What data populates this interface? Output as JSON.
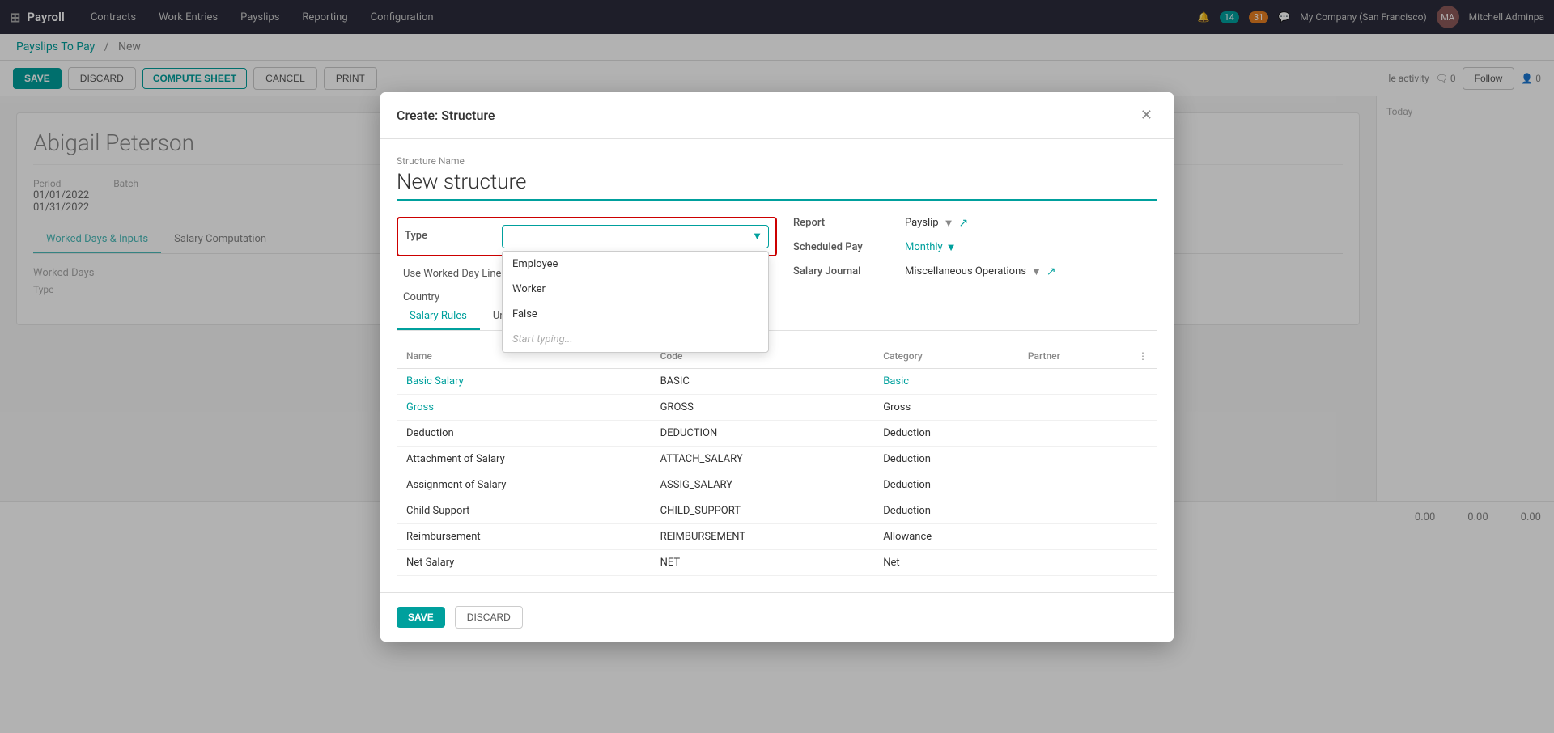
{
  "app": {
    "name": "Payroll",
    "grid_icon": "⊞"
  },
  "nav": {
    "items": [
      {
        "label": "Contracts"
      },
      {
        "label": "Work Entries"
      },
      {
        "label": "Payslips"
      },
      {
        "label": "Reporting"
      },
      {
        "label": "Configuration"
      }
    ]
  },
  "nav_right": {
    "badge1": "14",
    "badge2": "31",
    "company": "My Company (San Francisco)",
    "user": "Mitchell Adminpa"
  },
  "breadcrumb": {
    "parent": "Payslips To Pay",
    "current": "New"
  },
  "toolbar": {
    "save_label": "SAVE",
    "discard_label": "DISCARD",
    "compute_sheet_label": "COMPUTE SHEET",
    "cancel_label": "CANCEL",
    "print_label": "PRINT"
  },
  "employee": {
    "name": "Abigail Peterson",
    "period_label": "Period",
    "period_start": "01/01/2022",
    "period_end": "01/31/2022",
    "batch_label": "Batch"
  },
  "tabs": [
    {
      "label": "Worked Days & Inputs",
      "active": true
    },
    {
      "label": "Salary Computation"
    }
  ],
  "worked_days": {
    "title": "Worked Days",
    "type_label": "Type"
  },
  "sidebar": {
    "today_label": "Today",
    "follow_label": "Follow",
    "msg_count": "0",
    "follower_count": "0"
  },
  "modal": {
    "title": "Create: Structure",
    "structure_name_label": "Structure Name",
    "structure_name": "New structure",
    "type_label": "Type",
    "use_worked_day_label": "Use Worked Day Lines",
    "country_label": "Country",
    "report_label": "Report",
    "report_value": "Payslip",
    "scheduled_pay_label": "Scheduled Pay",
    "scheduled_pay_value": "Monthly",
    "salary_journal_label": "Salary Journal",
    "salary_journal_value": "Miscellaneous Operations",
    "type_options": [
      {
        "label": "Employee",
        "selected": false
      },
      {
        "label": "Worker",
        "selected": false
      },
      {
        "label": "False",
        "selected": false
      },
      {
        "label": "Start typing...",
        "placeholder": true
      }
    ],
    "tabs": [
      {
        "label": "Salary Rules",
        "active": true
      },
      {
        "label": "Unpaid"
      }
    ],
    "table": {
      "columns": [
        "Name",
        "Code",
        "Category",
        "Partner"
      ],
      "rows": [
        {
          "name": "Basic Salary",
          "code": "BASIC",
          "category": "Basic",
          "partner": ""
        },
        {
          "name": "Gross",
          "code": "GROSS",
          "category": "Gross",
          "partner": ""
        },
        {
          "name": "Deduction",
          "code": "DEDUCTION",
          "category": "Deduction",
          "partner": ""
        },
        {
          "name": "Attachment of Salary",
          "code": "ATTACH_SALARY",
          "category": "Deduction",
          "partner": ""
        },
        {
          "name": "Assignment of Salary",
          "code": "ASSIG_SALARY",
          "category": "Deduction",
          "partner": ""
        },
        {
          "name": "Child Support",
          "code": "CHILD_SUPPORT",
          "category": "Deduction",
          "partner": ""
        },
        {
          "name": "Reimbursement",
          "code": "REIMBURSEMENT",
          "category": "Allowance",
          "partner": ""
        },
        {
          "name": "Net Salary",
          "code": "NET",
          "category": "Net",
          "partner": ""
        }
      ]
    },
    "save_label": "SAVE",
    "discard_label": "DISCARD"
  },
  "bottom": {
    "val1": "0.00",
    "val2": "0.00",
    "val3": "0.00"
  }
}
